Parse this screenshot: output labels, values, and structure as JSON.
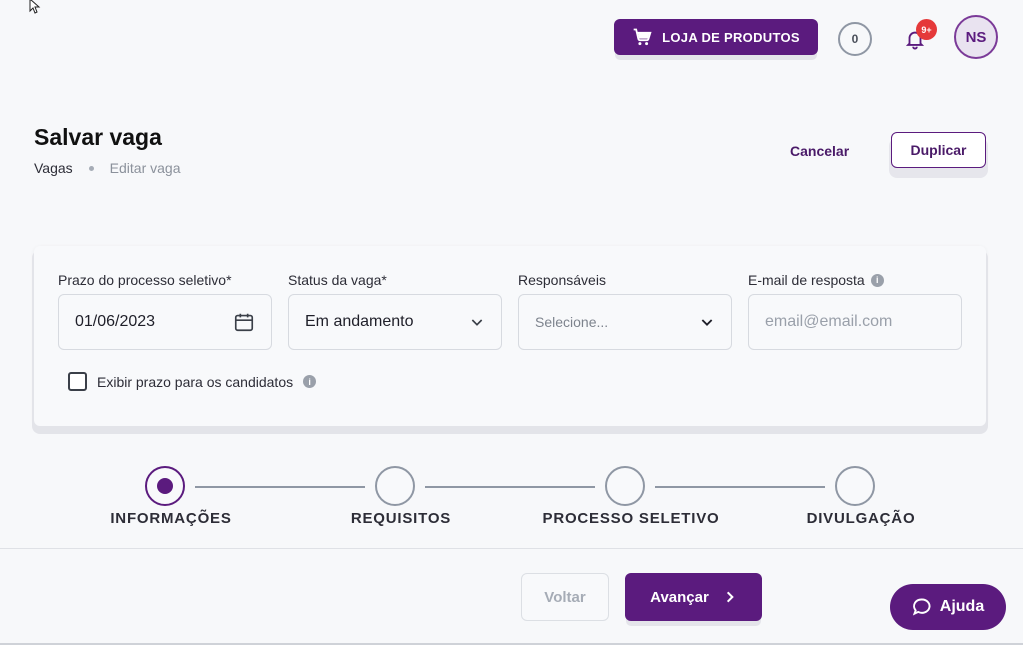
{
  "topbar": {
    "store_label": "LOJA DE PRODUTOS",
    "store_icon": "cart-icon",
    "coins": "0",
    "notifications_badge": "9+",
    "avatar_initials": "NS"
  },
  "header": {
    "title": "Salvar vaga",
    "breadcrumb": [
      "Vagas",
      "Editar vaga"
    ],
    "cancel_label": "Cancelar",
    "duplicate_label": "Duplicar"
  },
  "form": {
    "deadline": {
      "label": "Prazo do processo seletivo*",
      "value": "01/06/2023",
      "icon": "calendar-icon"
    },
    "status": {
      "label": "Status da vaga*",
      "value": "Em andamento",
      "icon": "chevron-down-icon"
    },
    "responsibles": {
      "label": "Responsáveis",
      "placeholder": "Selecione...",
      "icon": "chevron-down-icon"
    },
    "reply_email": {
      "label": "E-mail de resposta",
      "placeholder": "email@email.com",
      "info_icon": "i"
    },
    "show_deadline": {
      "label": "Exibir prazo para os candidatos",
      "checked": false,
      "info_icon": "i"
    }
  },
  "stepper": {
    "steps": [
      {
        "label": "INFORMAÇÕES",
        "active": true
      },
      {
        "label": "REQUISITOS",
        "active": false
      },
      {
        "label": "PROCESSO SELETIVO",
        "active": false
      },
      {
        "label": "DIVULGAÇÃO",
        "active": false
      }
    ]
  },
  "footer": {
    "back_label": "Voltar",
    "next_label": "Avançar",
    "help_label": "Ajuda"
  },
  "colors": {
    "primary": "#5b1b7e",
    "badge": "#e5393a",
    "neutral_line": "#8f97a4"
  }
}
